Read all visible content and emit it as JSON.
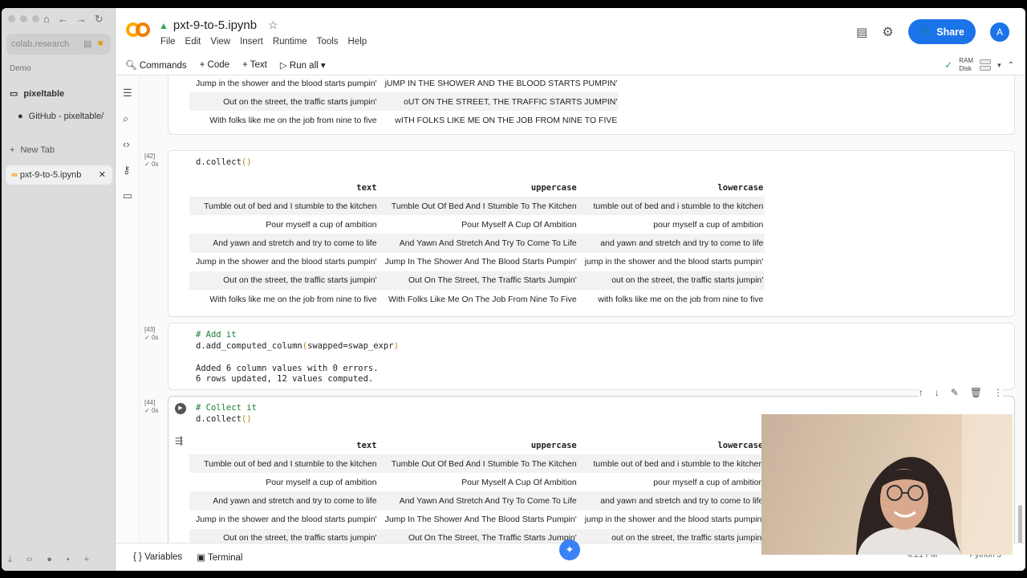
{
  "browser": {
    "url": "colab.research",
    "section": "Demo",
    "items": [
      {
        "label": "pixeltable"
      },
      {
        "label": "GitHub - pixeltable/"
      }
    ],
    "new_tab": "New Tab",
    "active_tab": "pxt-9-to-5.ipynb"
  },
  "notebook": {
    "filename": "pxt-9-to-5.ipynb",
    "menu": [
      "File",
      "Edit",
      "View",
      "Insert",
      "Runtime",
      "Tools",
      "Help"
    ],
    "share_label": "Share",
    "avatar_letter": "A",
    "toolbar": {
      "commands": "Commands",
      "code": "Code",
      "text": "Text",
      "run_all": "Run all"
    },
    "ram_label": "RAM",
    "disk_label": "Disk"
  },
  "top_partial_rows": [
    {
      "text": "Jump in the shower and the blood starts pumpin'",
      "swapped": "jUMP IN THE SHOWER AND THE BLOOD STARTS PUMPIN'"
    },
    {
      "text": "Out on the street, the traffic starts jumpin'",
      "swapped": "oUT ON THE STREET, THE TRAFFIC STARTS JUMPIN'"
    },
    {
      "text": "With folks like me on the job from nine to five",
      "swapped": "wITH FOLKS LIKE ME ON THE JOB FROM NINE TO FIVE"
    }
  ],
  "cells": {
    "c42": {
      "num": "[42]",
      "time": "0s",
      "code": "d.collect()"
    },
    "c43": {
      "num": "[43]",
      "time": "0s",
      "comment": "# Add it",
      "code_fn": "d.add_computed_column",
      "code_arg": "swapped=swap_expr",
      "output1": "Added 6 column values with 0 errors.",
      "output2": "6 rows updated, 12 values computed."
    },
    "c44": {
      "num": "[44]",
      "time": "0s",
      "comment": "# Collect it",
      "code": "d.collect()"
    }
  },
  "table": {
    "headers": [
      "text",
      "uppercase",
      "lowercase"
    ],
    "rows": [
      [
        "Tumble out of bed and I stumble to the kitchen",
        "Tumble Out Of Bed And I Stumble To The Kitchen",
        "tumble out of bed and i stumble to the kitchen"
      ],
      [
        "Pour myself a cup of ambition",
        "Pour Myself A Cup Of Ambition",
        "pour myself a cup of ambition"
      ],
      [
        "And yawn and stretch and try to come to life",
        "And Yawn And Stretch And Try To Come To Life",
        "and yawn and stretch and try to come to life"
      ],
      [
        "Jump in the shower and the blood starts pumpin'",
        "Jump In The Shower And The Blood Starts Pumpin'",
        "jump in the shower and the blood starts pumpin'"
      ],
      [
        "Out on the street, the traffic starts jumpin'",
        "Out On The Street, The Traffic Starts Jumpin'",
        "out on the street, the traffic starts jumpin'"
      ],
      [
        "With folks like me on the job from nine to five",
        "With Folks Like Me On The Job From Nine To Five",
        "with folks like me on the job from nine to five"
      ]
    ]
  },
  "bottom": {
    "variables": "Variables",
    "terminal": "Terminal",
    "time": "4:21 PM",
    "kernel": "Python 3"
  }
}
